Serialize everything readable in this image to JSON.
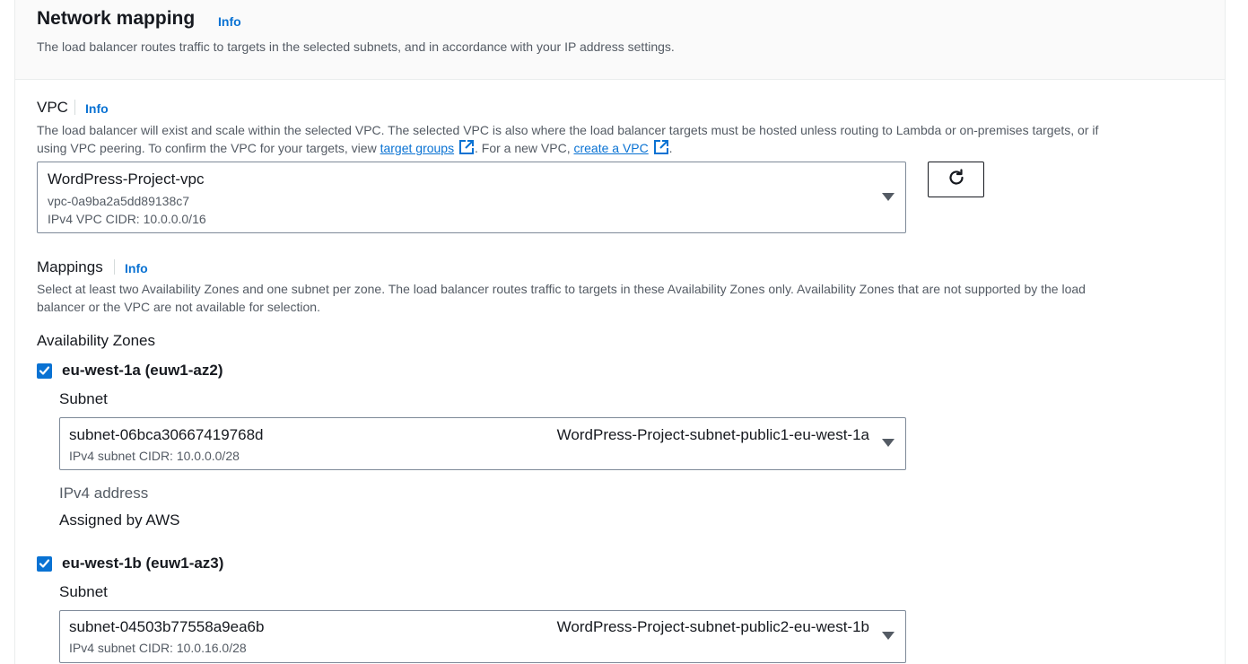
{
  "section": {
    "title": "Network mapping",
    "info": "Info",
    "description": "The load balancer routes traffic to targets in the selected subnets, and in accordance with your IP address settings."
  },
  "vpc": {
    "label": "VPC",
    "info": "Info",
    "description_line1": "The load balancer will exist and scale within the selected VPC. The selected VPC is also where the load balancer targets must be hosted unless routing to Lambda or on-premises targets, or if",
    "description_line2_pre": "using VPC peering. To confirm the VPC for your targets, view ",
    "target_groups_link": "target groups",
    "description_line2_mid": ". For a new VPC, ",
    "create_vpc_link": "create a VPC",
    "description_line2_post": ".",
    "selected_name": "WordPress-Project-vpc",
    "selected_id": "vpc-0a9ba2a5dd89138c7",
    "selected_cidr": "IPv4 VPC CIDR: 10.0.0.0/16",
    "refresh_icon": "refresh-icon"
  },
  "mappings": {
    "label": "Mappings",
    "info": "Info",
    "description_line1": "Select at least two Availability Zones and one subnet per zone. The load balancer routes traffic to targets in these Availability Zones only. Availability Zones that are not supported by the load",
    "description_line2": "balancer or the VPC are not available for selection.",
    "az_heading": "Availability Zones"
  },
  "zones": [
    {
      "name": "eu-west-1a (euw1-az2)",
      "checked": true,
      "subnet_label": "Subnet",
      "subnet_id": "subnet-06bca30667419768d",
      "subnet_name": "WordPress-Project-subnet-public1-eu-west-1a",
      "subnet_cidr": "IPv4 subnet CIDR: 10.0.0.0/28",
      "ipv4_label": "IPv4 address",
      "ipv4_value": "Assigned by AWS"
    },
    {
      "name": "eu-west-1b (euw1-az3)",
      "checked": true,
      "subnet_label": "Subnet",
      "subnet_id": "subnet-04503b77558a9ea6b",
      "subnet_name": "WordPress-Project-subnet-public2-eu-west-1b",
      "subnet_cidr": "IPv4 subnet CIDR: 10.0.16.0/28"
    }
  ],
  "colors": {
    "link": "#0972d3",
    "checkbox": "#0972d3",
    "text": "#16191f",
    "secondary": "#545b64"
  }
}
